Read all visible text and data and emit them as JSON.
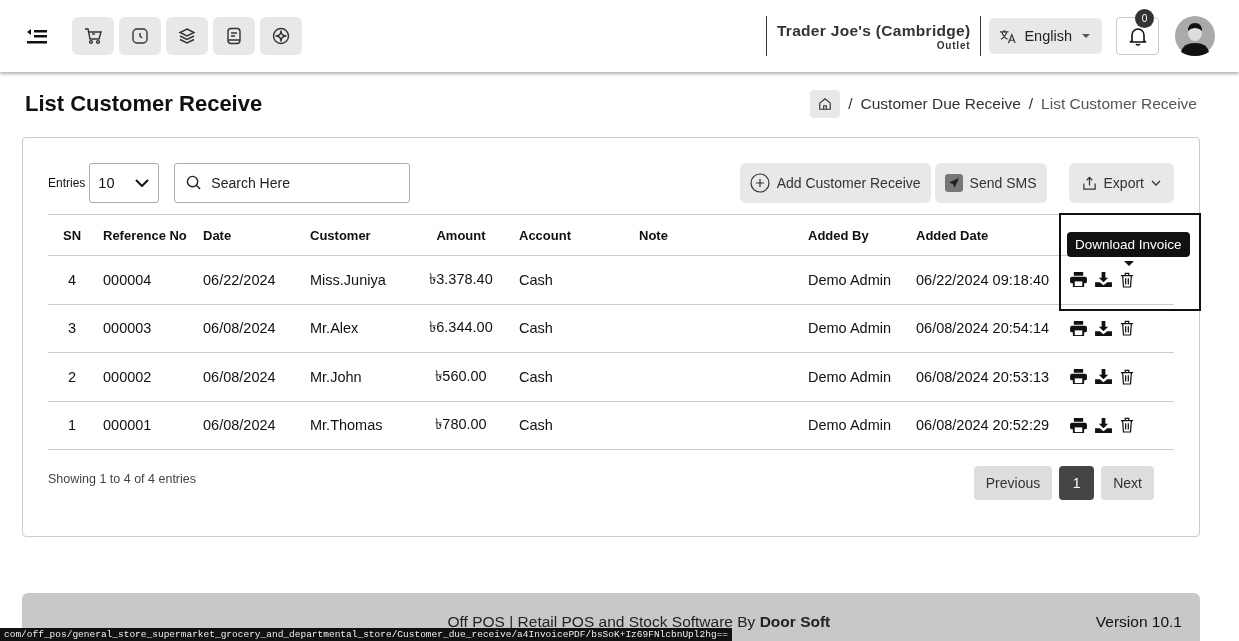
{
  "header": {
    "store_name": "Trader Joe's (Cambridge)",
    "store_type": "Outlet",
    "language": "English",
    "notification_count": "0"
  },
  "page": {
    "title": "List Customer Receive",
    "breadcrumb_separator": "/",
    "breadcrumb": [
      "Customer Due Receive",
      "List Customer Receive"
    ]
  },
  "controls": {
    "entries_label": "Entries",
    "entries_value": "10",
    "search_placeholder": "Search Here",
    "buttons": [
      {
        "kind": "add",
        "label": "Add Customer Receive"
      },
      {
        "kind": "sms",
        "label": "Send SMS"
      },
      {
        "kind": "export",
        "label": "Export"
      }
    ]
  },
  "table": {
    "columns": [
      "SN",
      "Reference No",
      "Date",
      "Customer",
      "Amount",
      "Account",
      "Note",
      "Added By",
      "Added Date"
    ],
    "rows": [
      {
        "sn": "4",
        "reference_no": "000004",
        "date": "06/22/2024",
        "customer": "Miss.Juniya",
        "amount": "৳3.378.40",
        "account": "Cash",
        "added_by": "Demo Admin",
        "added_date": "06/22/2024 09:18:40"
      },
      {
        "sn": "3",
        "reference_no": "000003",
        "date": "06/08/2024",
        "customer": "Mr.Alex",
        "amount": "৳6.344.00",
        "account": "Cash",
        "added_by": "Demo Admin",
        "added_date": "06/08/2024 20:54:14"
      },
      {
        "sn": "2",
        "reference_no": "000002",
        "date": "06/08/2024",
        "customer": "Mr.John",
        "amount": "৳560.00",
        "account": "Cash",
        "added_by": "Demo Admin",
        "added_date": "06/08/2024 20:53:13"
      },
      {
        "sn": "1",
        "reference_no": "000001",
        "date": "06/08/2024",
        "customer": "Mr.Thomas",
        "amount": "৳780.00",
        "account": "Cash",
        "added_by": "Demo Admin",
        "added_date": "06/08/2024 20:52:29"
      }
    ],
    "tooltip": "Download Invoice"
  },
  "pagination": {
    "summary": "Showing 1 to 4 of 4 entries",
    "previous": "Previous",
    "pages": [
      {
        "label": "1",
        "selected": true
      }
    ],
    "next": "Next"
  },
  "footer": {
    "text": "Off POS | Retail POS and Stock Software By **Door Soft**",
    "version": "Version 10.1"
  },
  "status_bar": {
    "url": "com/off_pos/general_store_supermarket_grocery_and_departmental_store/Customer_due_receive/a4InvoicePDF/bsSoK+Iz69FNlcbnUpl2hg=="
  }
}
